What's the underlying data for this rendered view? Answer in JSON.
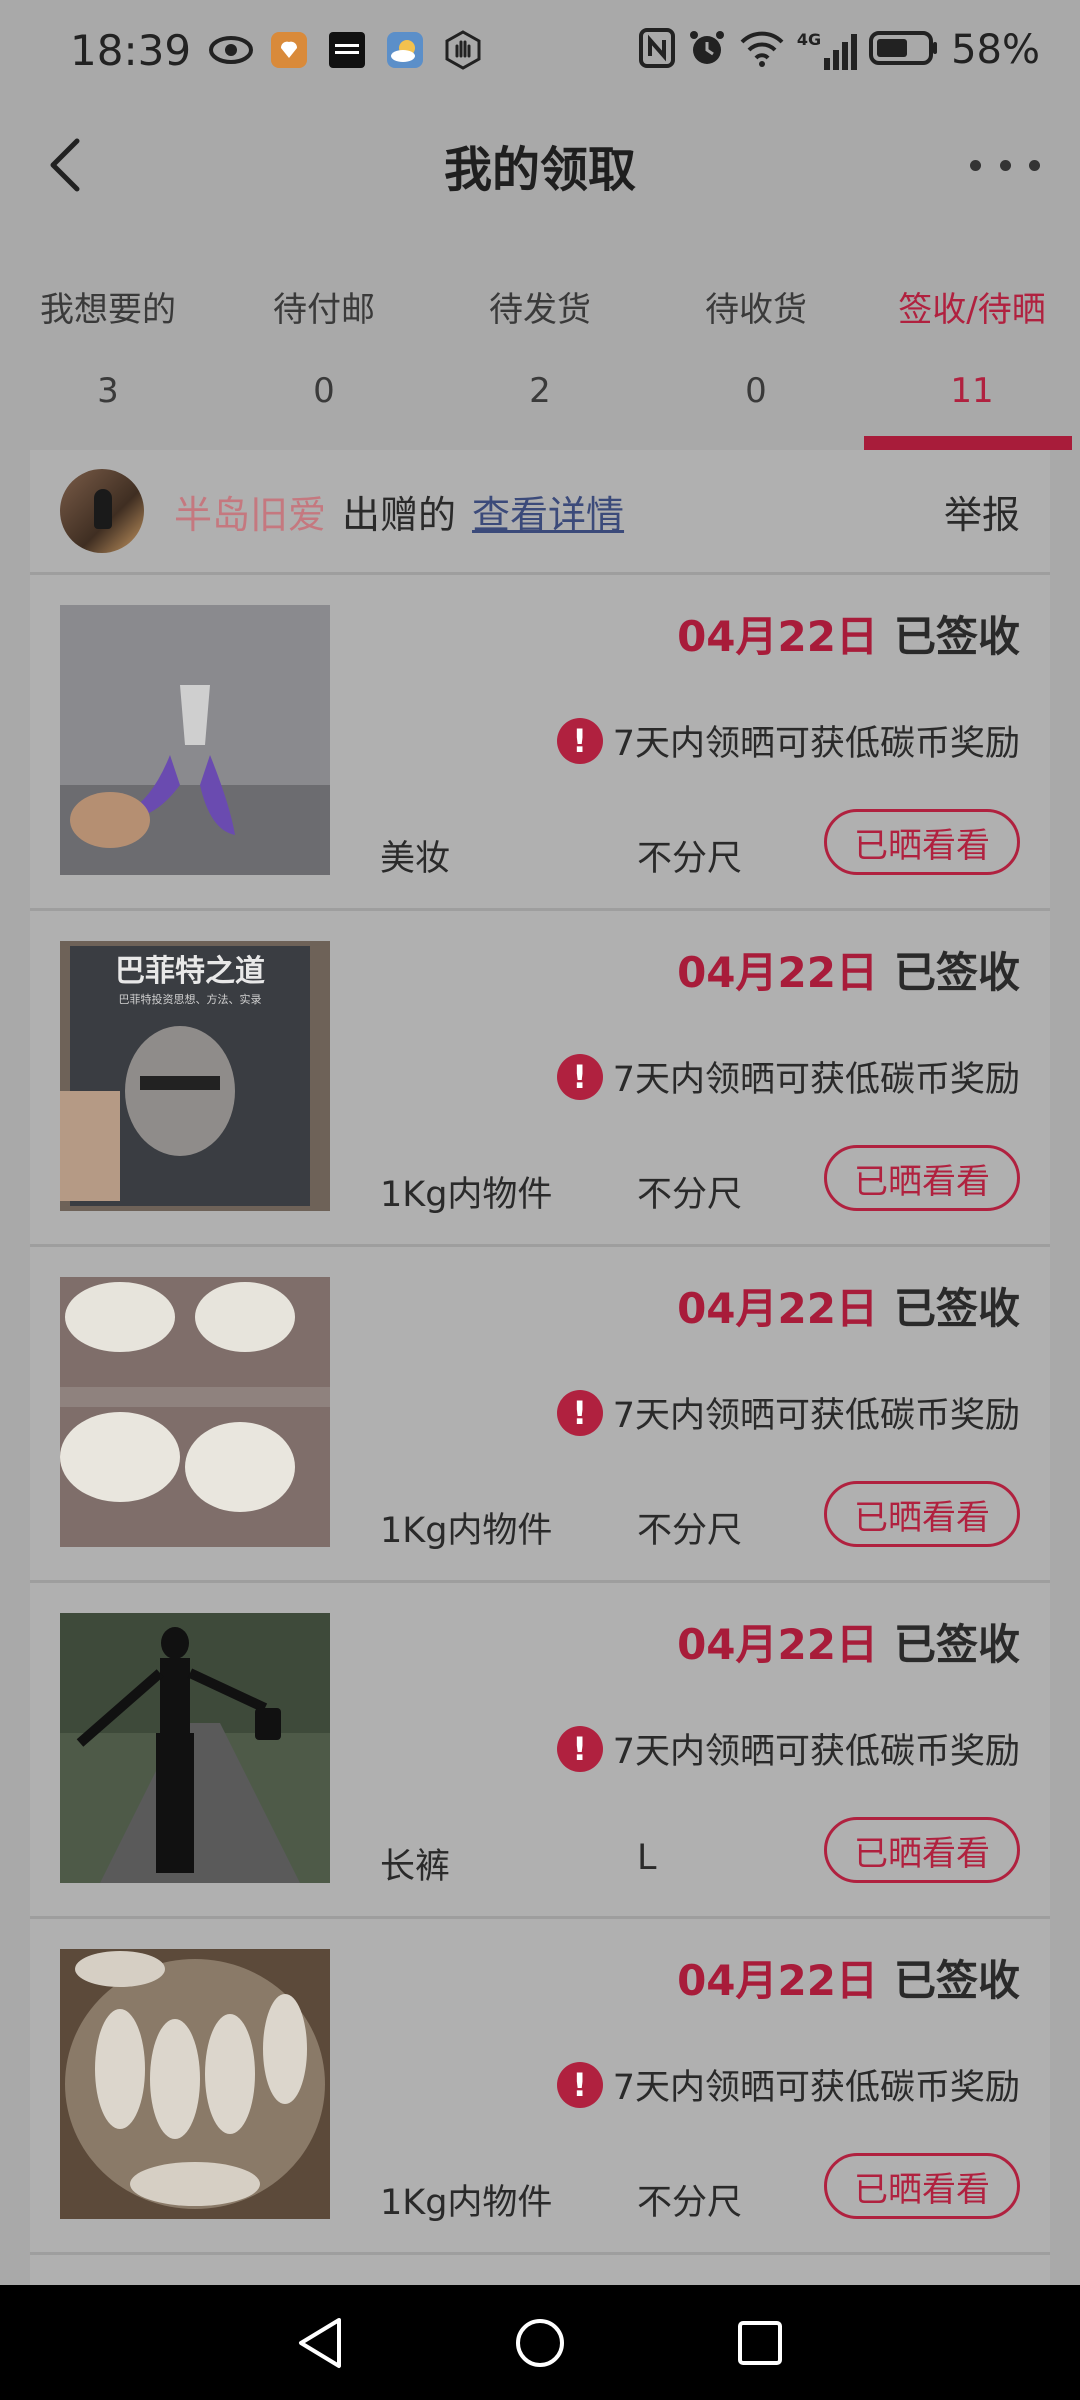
{
  "status_bar": {
    "time": "18:39",
    "left_icons": [
      "eye-icon",
      "app-shield-icon",
      "app-news-icon",
      "weather-icon",
      "hand-icon"
    ],
    "right_icons": [
      "nfc-icon",
      "alarm-icon",
      "wifi-icon",
      "signal-4g-icon",
      "battery-icon"
    ],
    "network": "4G",
    "battery": "58%"
  },
  "header": {
    "title": "我的领取"
  },
  "tabs": [
    {
      "label": "我想要的",
      "count": "3"
    },
    {
      "label": "待付邮",
      "count": "0"
    },
    {
      "label": "待发货",
      "count": "2"
    },
    {
      "label": "待收货",
      "count": "0"
    },
    {
      "label": "签收/待晒",
      "count": "11",
      "active": true
    }
  ],
  "giver": {
    "name": "半岛旧爱",
    "suffix": "出赠的",
    "detail_link": "查看详情",
    "report": "举报"
  },
  "items": [
    {
      "date": "04月22日",
      "status": "已签收",
      "notice": "7天内领晒可获低碳币奖励",
      "category": "美妆",
      "size": "不分尺",
      "action": "已晒看看"
    },
    {
      "date": "04月22日",
      "status": "已签收",
      "notice": "7天内领晒可获低碳币奖励",
      "category": "1Kg内物件",
      "size": "不分尺",
      "action": "已晒看看",
      "image_text_title": "巴菲特之道",
      "image_text_sub": "巴菲特投资思想、方法、实录"
    },
    {
      "date": "04月22日",
      "status": "已签收",
      "notice": "7天内领晒可获低碳币奖励",
      "category": "1Kg内物件",
      "size": "不分尺",
      "action": "已晒看看"
    },
    {
      "date": "04月22日",
      "status": "已签收",
      "notice": "7天内领晒可获低碳币奖励",
      "category": "长裤",
      "size": "L",
      "action": "已晒看看"
    },
    {
      "date": "04月22日",
      "status": "已签收",
      "notice": "7天内领晒可获低碳币奖励",
      "category": "1Kg内物件",
      "size": "不分尺",
      "action": "已晒看看"
    }
  ],
  "colors": {
    "accent": "#b0213f",
    "dim_background": "#a9a9a9"
  }
}
